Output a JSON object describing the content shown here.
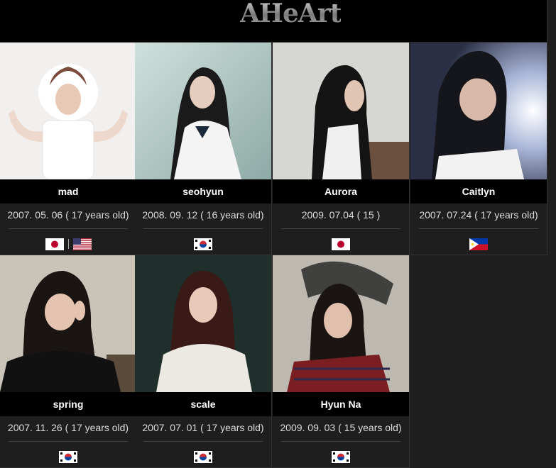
{
  "header": {
    "logo_text": "AHeArt"
  },
  "members": [
    {
      "name": "mad",
      "birth": "2007. 05. 06 ( 17 years old)",
      "flags": [
        "japan-flag-icon",
        "usa-flag-icon"
      ]
    },
    {
      "name": "seohyun",
      "birth": "2008. 09. 12 ( 16 years old)",
      "flags": [
        "korea-flag-icon"
      ]
    },
    {
      "name": "Aurora",
      "birth": "2009. 07.04 ( 15 )",
      "flags": [
        "japan-flag-icon"
      ]
    },
    {
      "name": "Caitlyn",
      "birth": "2007. 07.24 ( 17 years old)",
      "flags": [
        "philippines-flag-icon"
      ]
    },
    {
      "name": "spring",
      "birth": "2007. 11. 26 ( 17 years old)",
      "flags": [
        "korea-flag-icon"
      ]
    },
    {
      "name": "scale",
      "birth": "2007. 07. 01 ( 17 years old)",
      "flags": [
        "korea-flag-icon"
      ]
    },
    {
      "name": "Hyun Na",
      "birth": "2009. 09. 03 ( 15 years old)",
      "flags": [
        "korea-flag-icon"
      ]
    }
  ],
  "colors": {
    "background": "#1e1e1e",
    "header": "#000000",
    "name_bar": "#000000"
  }
}
